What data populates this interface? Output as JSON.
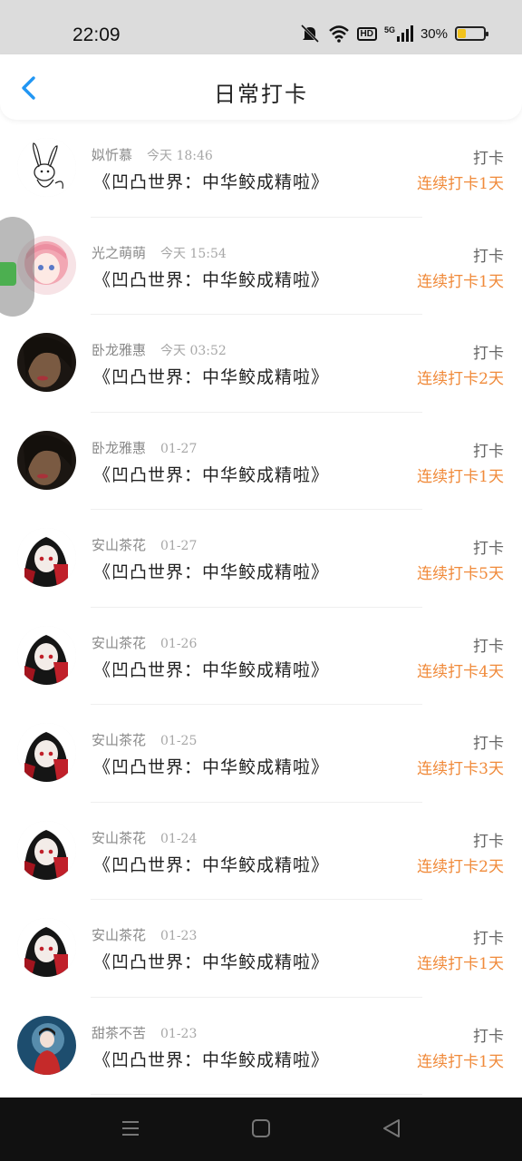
{
  "status": {
    "time": "22:09",
    "hd": "HD",
    "signal": "5G",
    "battery": "30%",
    "battery_level": 0.3,
    "battery_color": "#f2c21b"
  },
  "header": {
    "title": "日常打卡",
    "back_icon": "chevron-left-icon",
    "accent": "#2196f3"
  },
  "colors": {
    "streak": "#f08a3a"
  },
  "rows": [
    {
      "user": "姒忻慕",
      "when": "今天 18:46",
      "book": "《凹凸世界：中华鲛成精啦》",
      "action": "打卡",
      "streak": "连续打卡1天",
      "avatar": "rabbit-sketch"
    },
    {
      "user": "光之萌萌",
      "when": "今天 15:54",
      "book": "《凹凸世界：中华鲛成精啦》",
      "action": "打卡",
      "streak": "连续打卡1天",
      "avatar": "pink-hair-anime"
    },
    {
      "user": "卧龙雅惠",
      "when": "今天 03:52",
      "book": "《凹凸世界：中华鲛成精啦》",
      "action": "打卡",
      "streak": "连续打卡2天",
      "avatar": "dark-portrait"
    },
    {
      "user": "卧龙雅惠",
      "when": "01-27",
      "book": "《凹凸世界：中华鲛成精啦》",
      "action": "打卡",
      "streak": "连续打卡1天",
      "avatar": "dark-portrait"
    },
    {
      "user": "安山茶花",
      "when": "01-27",
      "book": "《凹凸世界：中华鲛成精啦》",
      "action": "打卡",
      "streak": "连续打卡5天",
      "avatar": "black-red-anime"
    },
    {
      "user": "安山茶花",
      "when": "01-26",
      "book": "《凹凸世界：中华鲛成精啦》",
      "action": "打卡",
      "streak": "连续打卡4天",
      "avatar": "black-red-anime"
    },
    {
      "user": "安山茶花",
      "when": "01-25",
      "book": "《凹凸世界：中华鲛成精啦》",
      "action": "打卡",
      "streak": "连续打卡3天",
      "avatar": "black-red-anime"
    },
    {
      "user": "安山茶花",
      "when": "01-24",
      "book": "《凹凸世界：中华鲛成精啦》",
      "action": "打卡",
      "streak": "连续打卡2天",
      "avatar": "black-red-anime"
    },
    {
      "user": "安山茶花",
      "when": "01-23",
      "book": "《凹凸世界：中华鲛成精啦》",
      "action": "打卡",
      "streak": "连续打卡1天",
      "avatar": "black-red-anime"
    },
    {
      "user": "甜茶不苦",
      "when": "01-23",
      "book": "《凹凸世界：中华鲛成精啦》",
      "action": "打卡",
      "streak": "连续打卡1天",
      "avatar": "blue-night-girl"
    }
  ],
  "navbar": {
    "menu_icon": "menu-icon",
    "home_icon": "home-square-icon",
    "back_icon": "back-triangle-icon"
  }
}
